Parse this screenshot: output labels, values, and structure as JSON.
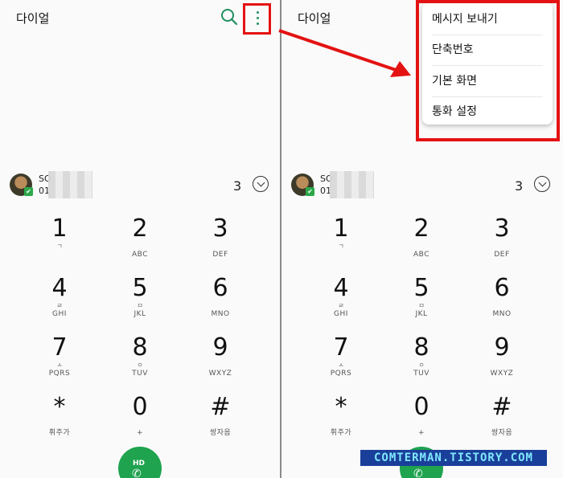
{
  "title": "다이얼",
  "contact": {
    "name": "SO",
    "number": "01",
    "match_count": "3"
  },
  "keys": [
    {
      "digit": "1",
      "sub": "ㄱ",
      "letters": ""
    },
    {
      "digit": "2",
      "sub": "",
      "letters": "ABC"
    },
    {
      "digit": "3",
      "sub": "",
      "letters": "DEF"
    },
    {
      "digit": "4",
      "sub": "ㄹ",
      "letters": "GHI"
    },
    {
      "digit": "5",
      "sub": "ㅁ",
      "letters": "JKL"
    },
    {
      "digit": "6",
      "sub": "",
      "letters": "MNO"
    },
    {
      "digit": "7",
      "sub": "ㅅ",
      "letters": "PQRS"
    },
    {
      "digit": "8",
      "sub": "ㅇ",
      "letters": "TUV"
    },
    {
      "digit": "9",
      "sub": "",
      "letters": "WXYZ"
    },
    {
      "digit": "*",
      "sub": "",
      "letters": "휘주가"
    },
    {
      "digit": "0",
      "sub": "",
      "letters": "+"
    },
    {
      "digit": "#",
      "sub": "",
      "letters": "쌍자음"
    }
  ],
  "call_label": "HD",
  "menu": {
    "items": [
      "메시지 보내기",
      "단축번호",
      "기본 화면",
      "통화 설정"
    ]
  },
  "watermark": "COMTERMAN.TISTORY.COM",
  "colors": {
    "accent": "#1fa34f",
    "highlight": "#e41212",
    "watermark_bg": "#1a3f9a"
  },
  "icons": {
    "search": "search-icon",
    "more": "more-vert-icon",
    "call": "phone-icon"
  }
}
